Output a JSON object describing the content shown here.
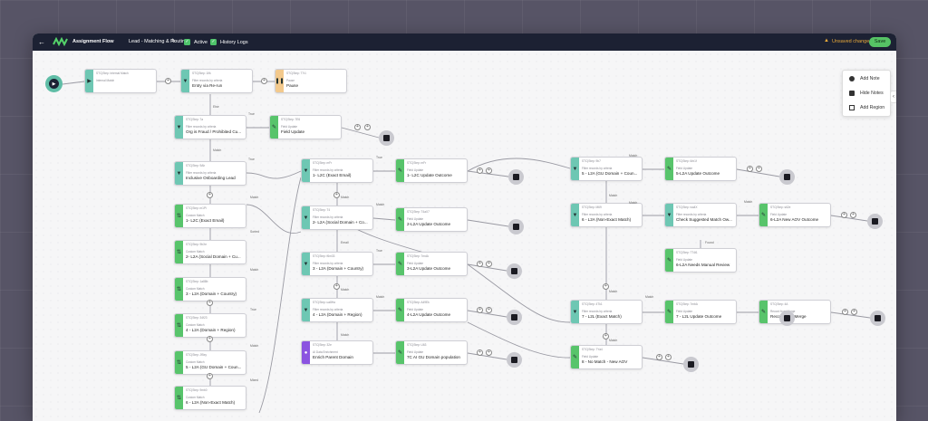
{
  "topbar": {
    "back_icon": "arrow-left-icon",
    "logo_icon": "wave-logo-icon",
    "app_title": "Assignment Flow",
    "flow_name": "Lead - Matching & Routing",
    "edit_icon": "pencil-icon",
    "active_label": "Active",
    "history_label": "History Logs",
    "warning_icon": "warning-icon",
    "unsaved_label": "Unsaved changes",
    "save_label": "Save"
  },
  "menu": {
    "items": [
      {
        "label": "Add Note",
        "icon": "note-icon"
      },
      {
        "label": "Hide Notes",
        "icon": "eye-off-icon"
      },
      {
        "label": "Add Region",
        "icon": "region-icon"
      }
    ]
  },
  "nodes": [
    {
      "meta": "STC|Step: Internal Match",
      "desc": "Internal Match",
      "title": ""
    },
    {
      "meta": "STC|Step: 1Ifk",
      "desc": "Filter records by criteria",
      "title": "Entry via Re-run"
    },
    {
      "meta": "STC|Step: 77r1",
      "desc": "Pause",
      "title": "Pause"
    },
    {
      "meta": "STC|Step: 7a",
      "desc": "Filter records by criteria",
      "title": "Org is Fraud / Prohibited Cu..."
    },
    {
      "meta": "STC|Step: 7E6",
      "desc": "Field Update",
      "title": "Field Update"
    },
    {
      "meta": "STC|Step: 9Ah",
      "desc": "Filter records by criteria",
      "title": "Inclusive Onboarding Lead"
    },
    {
      "meta": "STC|Step: m1Pi",
      "desc": "Custom Match",
      "title": "1- L2C (Exact Email)"
    },
    {
      "meta": "STC|Step: 9bXe",
      "desc": "Custom Match",
      "title": "2- L2A (Social Domain + Cu..."
    },
    {
      "meta": "STC|Step: 1a88b",
      "desc": "Custom Match",
      "title": "3 - L2A (Domain + Country)"
    },
    {
      "meta": "STC|Step: 34f23",
      "desc": "Custom Match",
      "title": "4 - L2A (Domain + Region)"
    },
    {
      "meta": "STC|Step: Jf5xy",
      "desc": "Custom Match",
      "title": "5 - L2A (GU Domain + Coun..."
    },
    {
      "meta": "STC|Step: 9mb0",
      "desc": "Custom Match",
      "title": "6 - L2A (Non-Exact Match)"
    },
    {
      "meta": "STC|Step: mFr",
      "desc": "Filter records by criteria",
      "title": "1- L2C (Exact Email)"
    },
    {
      "meta": "STC|Step: T4",
      "desc": "Filter records by criteria",
      "title": "2- L2A (Social Domain + Co..."
    },
    {
      "meta": "STC|Step: f6m33",
      "desc": "Filter records by criteria",
      "title": "3 - L2A (Domain + Country)"
    },
    {
      "meta": "STC|Step: ua8Ha",
      "desc": "Filter records by criteria",
      "title": "4 - L2A (Domain + Region)"
    },
    {
      "meta": "STC|Step: 32e",
      "desc": "AI Data Enrichment",
      "title": "Enrich Parent Domain"
    },
    {
      "meta": "STC|Step: mFr",
      "desc": "Field Update",
      "title": "1- L2C Update Outcome"
    },
    {
      "meta": "STC|Step: T4aX7",
      "desc": "Field Update",
      "title": "2-L2A Update Outcome"
    },
    {
      "meta": "STC|Step: 7mdA",
      "desc": "Field Update",
      "title": "3-L2A Update Outcome"
    },
    {
      "meta": "STC|Step: A49Ek",
      "desc": "Field Update",
      "title": "4-L2A Update Outcome"
    },
    {
      "meta": "STC|Step: U63",
      "desc": "Field Update",
      "title": "7C AI GU Domain population"
    },
    {
      "meta": "STC|Step: 9b7",
      "desc": "Filter records by criteria",
      "title": "5 - L2A (GU Domain + Coun..."
    },
    {
      "meta": "STC|Step: M69",
      "desc": "Filter records by criteria",
      "title": "6 - L2A (Non-Exact Match)"
    },
    {
      "meta": "STC|Step: 4Tk1",
      "desc": "Filter records by criteria",
      "title": "7 - L2L (Exact Match)"
    },
    {
      "meta": "STC|Step: 7Ya4",
      "desc": "Field Update",
      "title": "8 - No Match - New AOV"
    },
    {
      "meta": "STC|Step: 6rb1f",
      "desc": "Field Update",
      "title": "5-L2A Update Outcome"
    },
    {
      "meta": "STC|Step: wa4X",
      "desc": "Filter records by criteria",
      "title": "Check Suggested Match Ow..."
    },
    {
      "meta": "STC|Step: 7T4t1",
      "desc": "Field Update",
      "title": "6-L2A Needs Manual Review"
    },
    {
      "meta": "STC|Step: 7mbA",
      "desc": "Field Update",
      "title": "7 - L2L Update Outcome"
    },
    {
      "meta": "STC|Step: s62e",
      "desc": "Field Update",
      "title": "6-L2A New AOV Outcome"
    },
    {
      "meta": "STC|Step: 4A",
      "desc": "Record from Merge",
      "title": "Record Auto Merge"
    }
  ],
  "edge_labels": [
    "Else",
    "True",
    "Match",
    "True",
    "Match",
    "Sorted",
    "True",
    "Match",
    "True",
    "Match",
    "Match",
    "Match",
    "True",
    "Match",
    "Mixed",
    "Match",
    "Email",
    "Match",
    "Match",
    "Match",
    "Match",
    "Match",
    "Found",
    "Match",
    "Match",
    "Match"
  ],
  "colors": {
    "topbar": "#1c2133",
    "filter": "#6ec7b3",
    "field_update": "#58c46b",
    "pause": "#f3c98c",
    "ai": "#8b53e0",
    "save": "#56c365",
    "warning": "#e8a93a"
  }
}
